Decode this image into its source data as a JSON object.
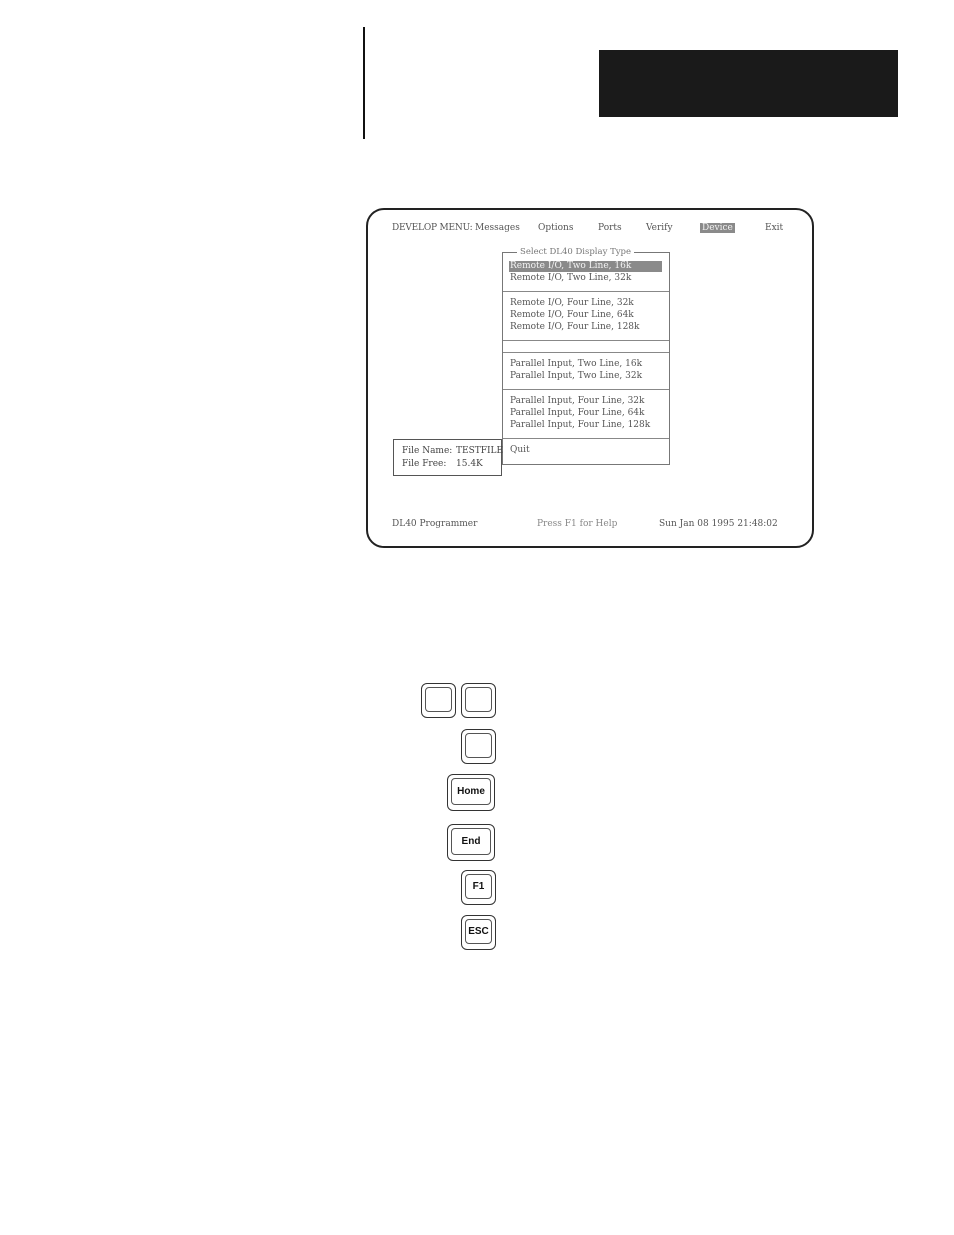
{
  "screen": {
    "menubar": {
      "label": "DEVELOP MENU:",
      "items": [
        {
          "label": "Messages"
        },
        {
          "label": "Options"
        },
        {
          "label": "Ports"
        },
        {
          "label": "Verify"
        },
        {
          "label": "Device",
          "active": true
        },
        {
          "label": "Exit"
        }
      ]
    },
    "popup": {
      "title": "Select DL40 Display Type",
      "options": [
        {
          "label": "Remote I/O, Two Line, 16k",
          "selected": true
        },
        {
          "label": "Remote I/O, Two Line, 32k"
        },
        {
          "label": "Remote I/O, Four Line, 32k"
        },
        {
          "label": "Remote I/O, Four Line, 64k"
        },
        {
          "label": "Remote I/O, Four Line, 128k"
        },
        {
          "label": "Parallel Input, Two Line, 16k"
        },
        {
          "label": "Parallel Input, Two Line, 32k"
        },
        {
          "label": "Parallel Input, Four Line, 32k"
        },
        {
          "label": "Parallel Input, Four Line, 64k"
        },
        {
          "label": "Parallel Input, Four Line, 128k"
        },
        {
          "label": "Quit"
        }
      ]
    },
    "file_info": {
      "name_label": "File Name:",
      "name_value": "TESTFILE",
      "free_label": "File Free:",
      "free_value": "15.4K"
    },
    "status_bar": {
      "app_name": "DL40 Programmer",
      "help_hint": "Press F1 for Help",
      "datetime": "Sun Jan 08 1995 21:48:02"
    }
  },
  "keys": {
    "up_arrow": "",
    "down_arrow": "",
    "enter": "",
    "home": "Home",
    "end": "End",
    "f1": "F1",
    "esc": "ESC"
  },
  "colors": {
    "highlight": "#8a8a8a",
    "screen_text": "#555555",
    "header_block": "#1a1a1a"
  }
}
